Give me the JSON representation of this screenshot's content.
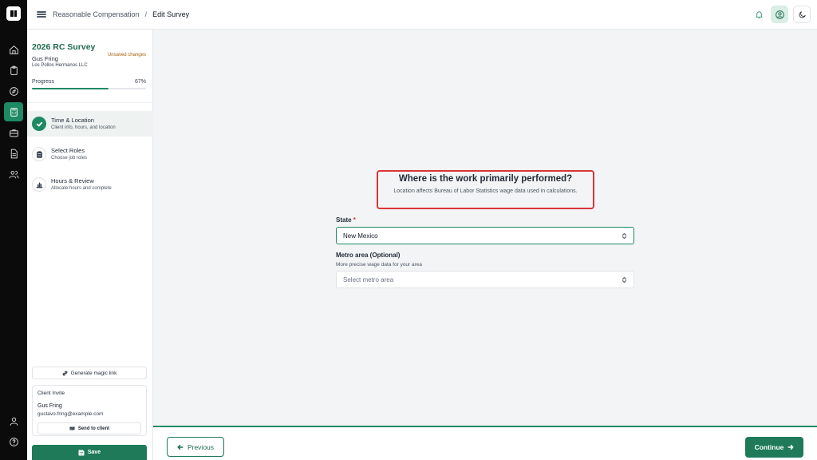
{
  "rail": {
    "icons": [
      "home-icon",
      "clipboard-icon",
      "compass-icon",
      "calculator-icon",
      "briefcase-icon",
      "document-icon",
      "users-icon",
      "user-icon",
      "help-icon"
    ],
    "active_icon": "calculator-icon",
    "accent": "#1e8a64"
  },
  "header": {
    "breadcrumb_root": "Reasonable Compensation",
    "breadcrumb_sep": "/",
    "breadcrumb_current": "Edit Survey"
  },
  "survey": {
    "title": "2026 RC Survey",
    "client_name": "Gus Fring",
    "company": "Los Pollos Hermanos LLC",
    "unsaved": "Unsaved changes",
    "progress_label": "Progress",
    "progress_text": "67%",
    "progress_value": 0.67
  },
  "steps": [
    {
      "title": "Time & Location",
      "subtitle": "Client info, hours, and location",
      "icon": "check-icon",
      "active": true
    },
    {
      "title": "Select Roles",
      "subtitle": "Choose job roles",
      "icon": "clipboard-icon",
      "active": false
    },
    {
      "title": "Hours & Review",
      "subtitle": "Allocate hours and complete",
      "icon": "bar-chart-icon",
      "active": false
    }
  ],
  "sidebar_actions": {
    "magic_link": "Generate magic link",
    "invite_heading": "Client Invite",
    "invite_name": "Gus Fring",
    "invite_email": "gustavo.fring@example.com",
    "send_label": "Send to client",
    "save_label": "Save"
  },
  "form": {
    "question": "Where is the work primarily performed?",
    "description": "Location affects Bureau of Labor Statistics wage data used in calculations.",
    "state_label": "State",
    "state_required": "*",
    "state_value": "New Mexico",
    "metro_label": "Metro area (Optional)",
    "metro_help": "More precise wage data for your area",
    "metro_placeholder": "Select metro area"
  },
  "footer": {
    "previous_label": "Previous",
    "continue_label": "Continue"
  },
  "colors": {
    "brand_green": "#1e7a58",
    "highlight_red": "#d9343b",
    "warning_text": "#a16207"
  }
}
